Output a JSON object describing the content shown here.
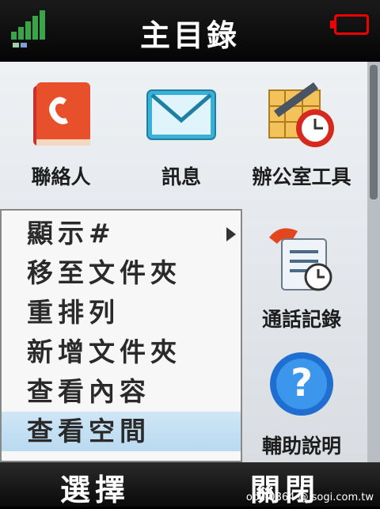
{
  "status_bar": {
    "title": "主目錄",
    "signal_icon": "signal-strength-icon",
    "battery_icon": "battery-empty-icon"
  },
  "main_menu": {
    "items": [
      {
        "label": "聯絡人",
        "icon": "phonebook-icon"
      },
      {
        "label": "訊息",
        "icon": "envelope-icon"
      },
      {
        "label": "辦公室工具",
        "icon": "office-tools-icon"
      },
      {
        "label": "通話記錄",
        "icon": "call-log-icon"
      },
      {
        "label": "輔助說明",
        "icon": "help-icon"
      }
    ]
  },
  "option_menu": {
    "items": [
      {
        "label": "顯示#"
      },
      {
        "label": "移至文件夾"
      },
      {
        "label": "重排列"
      },
      {
        "label": "新增文件夾"
      },
      {
        "label": "查看內容"
      },
      {
        "label": "查看空間"
      }
    ],
    "selected_index": 5
  },
  "softkeys": {
    "left": "選擇",
    "right": "關閉"
  },
  "watermark": "opk-0864 @ sogi.com.tw",
  "colors": {
    "accent_blue": "#b9d9ef",
    "battery_red": "#ee0000",
    "signal_green": "#3aa548"
  }
}
